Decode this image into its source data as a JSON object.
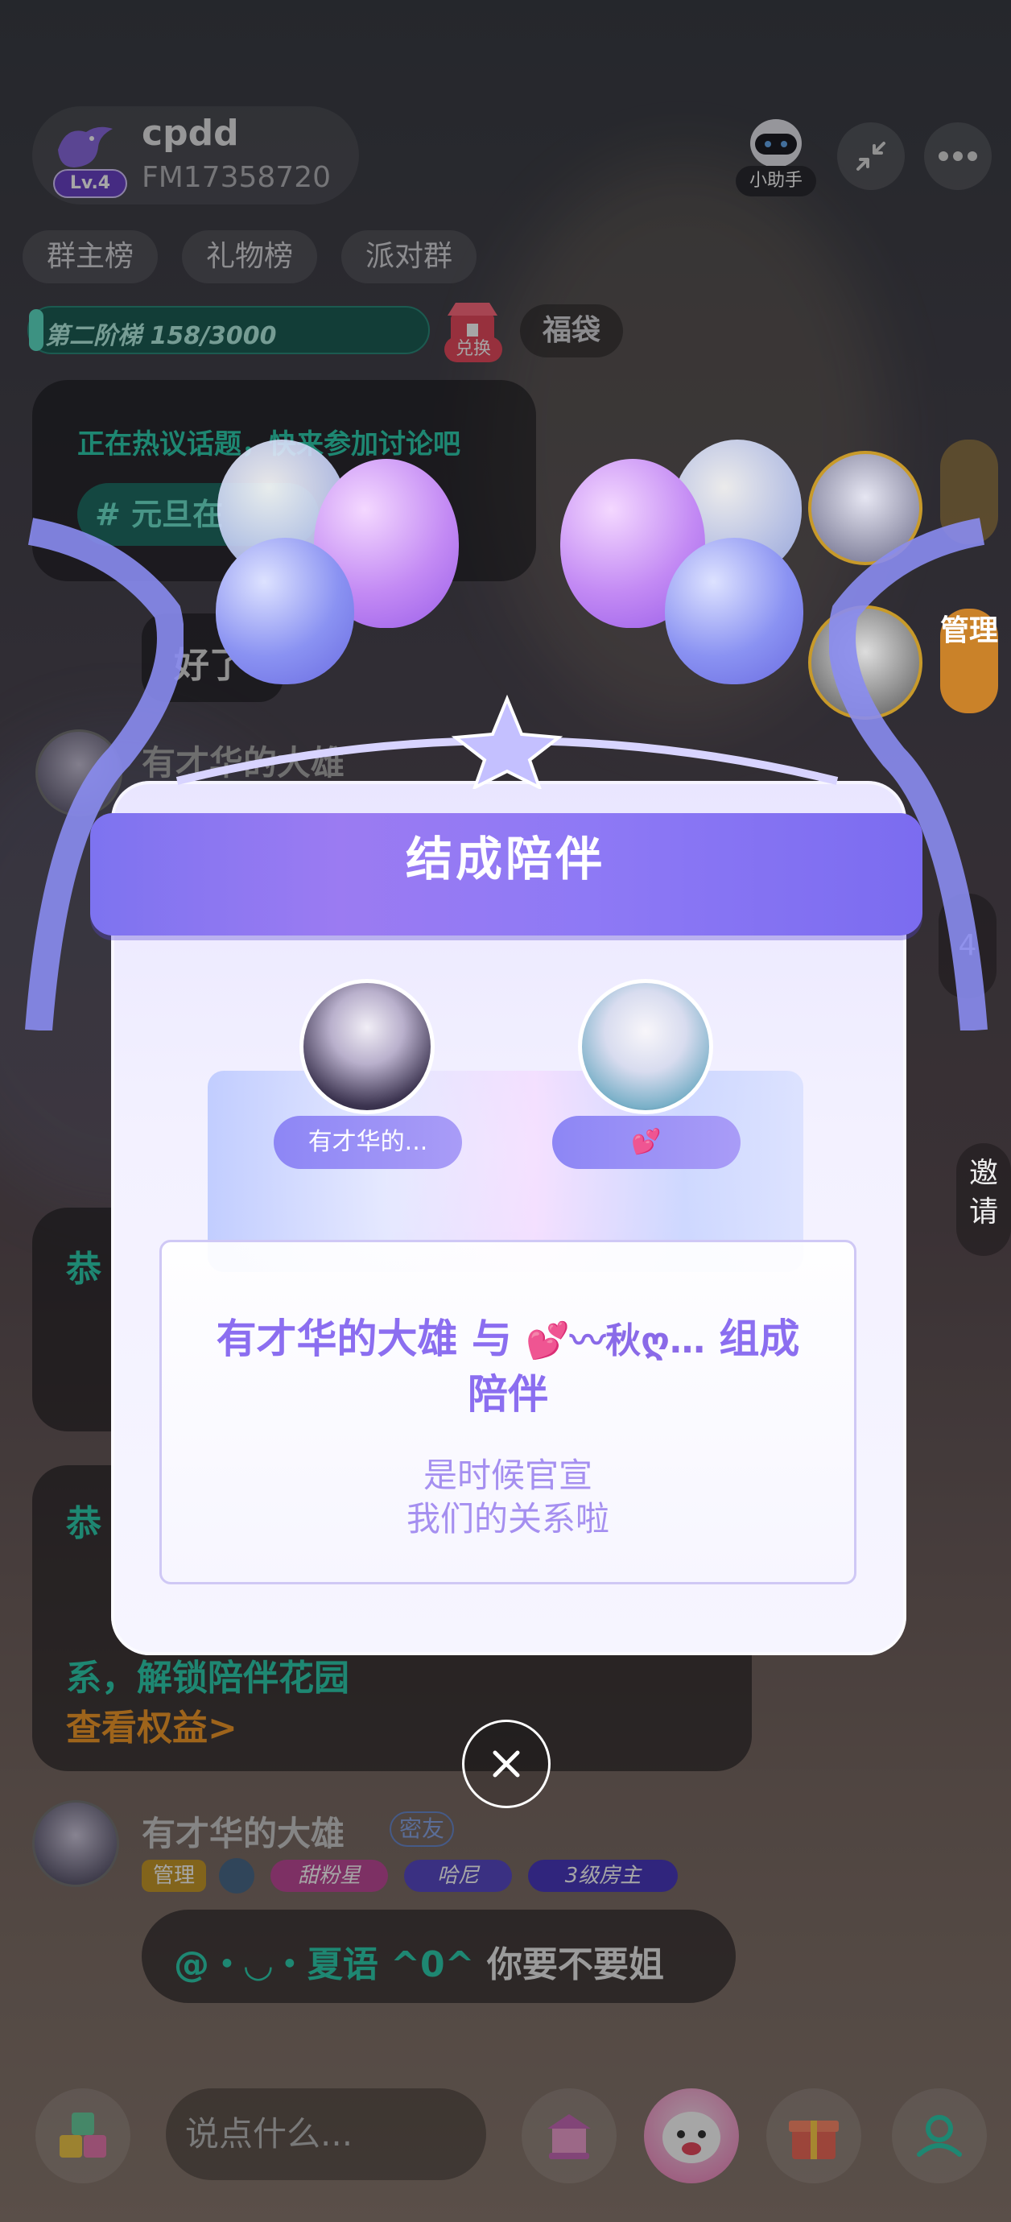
{
  "room": {
    "name": "cpdd",
    "id": "FM17358720",
    "level": "Lv.4",
    "assistant_label": "小助手"
  },
  "tabs": [
    "群主榜",
    "礼物榜",
    "派对群"
  ],
  "progress": {
    "text": "第二阶梯 158/3000",
    "current": 158,
    "total": 3000
  },
  "exchange_label": "兑换",
  "lucky_bag_label": "福袋",
  "topic": {
    "text": "正在热议话题，快来参加讨论吧",
    "tag": "# 元旦在"
  },
  "chat": {
    "msg_ok": "好了",
    "partial_name": "有才华的大雄",
    "congrats_1": "恭",
    "congrats_2": "恭",
    "unlock_text": "系，解锁陪伴花园",
    "view_rights": "查看权益>",
    "last_user": {
      "name": "有才华的大雄",
      "relation": "密友",
      "badges": [
        "管理",
        "甜粉星",
        "哈尼",
        "3级房主"
      ]
    },
    "last_message": {
      "mention": "@・◡・夏语 ^0^",
      "text": " 你要不要姐"
    }
  },
  "side": {
    "manage_label": "管理",
    "invite_label": "邀请",
    "count": "4"
  },
  "modal": {
    "title": "结成陪伴",
    "user_left": "有才华的...",
    "user_right": "💕",
    "message_main_a": "有才华的大雄 与 ",
    "message_main_b": "💕〰秋ღ…",
    "message_main_c": " 组成",
    "message_main_d": "陪伴",
    "message_sub_1": "是时候官宣",
    "message_sub_2": "我们的关系啦"
  },
  "input_placeholder": "说点什么...",
  "colors": {
    "accent_teal": "#2ed0b0",
    "accent_purple": "#8b6ef0",
    "accent_orange": "#f39a2a"
  }
}
